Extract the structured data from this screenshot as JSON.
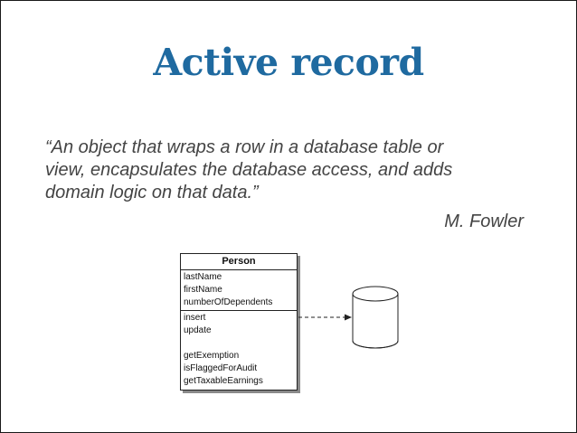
{
  "slide": {
    "title": "Active record",
    "quote_lines": [
      "“An object that wraps a row in a database table or",
      "view, encapsulates the database access, and adds",
      "domain logic on that data.”"
    ],
    "author": "M. Fowler"
  },
  "diagram": {
    "class_name": "Person",
    "attributes": [
      "lastName",
      "firstName",
      "numberOfDependents"
    ],
    "operations_group1": [
      "insert",
      "update"
    ],
    "operations_group2": [
      "getExemption",
      "isFlaggedForAudit",
      "getTaxableEarnings"
    ],
    "database_icon": "database-cylinder-icon",
    "arrow_style": "dashed"
  },
  "colors": {
    "title": "#1f6aa0",
    "text": "#444444",
    "diagram_stroke": "#222222"
  }
}
